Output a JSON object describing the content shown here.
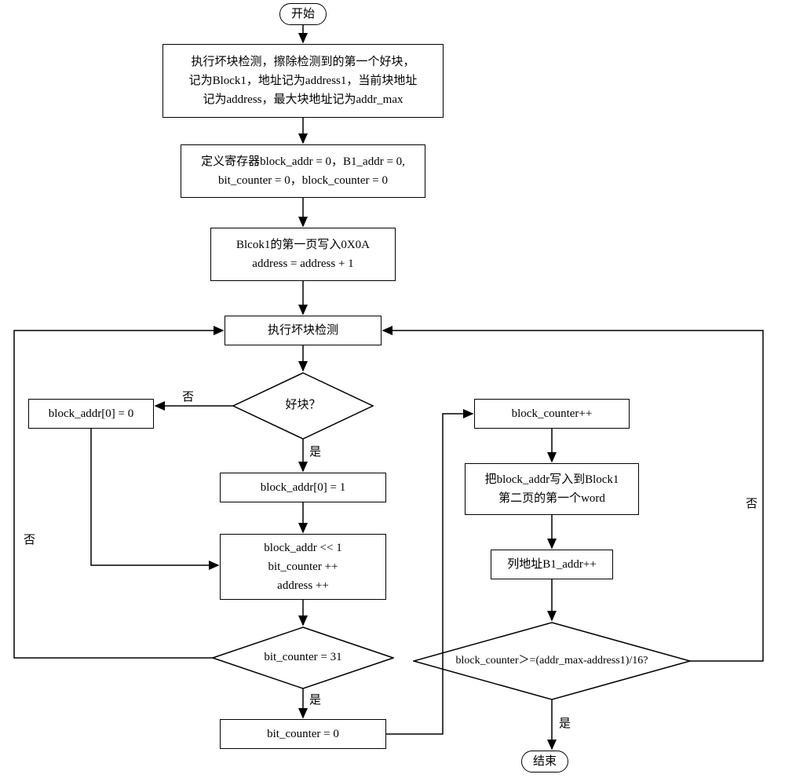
{
  "start": "开始",
  "end": "结束",
  "step1_l1": "执行坏块检测，擦除检测到的第一个好块，",
  "step1_l2": "记为Block1，地址记为address1，当前块地址",
  "step1_l3": "记为address，最大块地址记为addr_max",
  "step2_l1": "定义寄存器block_addr = 0，B1_addr = 0,",
  "step2_l2": "bit_counter = 0，block_counter = 0",
  "step3_l1": "Blcok1的第一页写入0X0A",
  "step3_l2": "address = address + 1",
  "step4": "执行坏块检测",
  "decision1": "好块？",
  "no_set": "block_addr[0] = 0",
  "yes_set": "block_addr[0] = 1",
  "shift_l1": "block_addr << 1",
  "shift_l2": "bit_counter ++",
  "shift_l3": "address ++",
  "decision2": "bit_counter = 31",
  "reset": "bit_counter = 0",
  "inc_counter": "block_counter++",
  "write_l1": "把block_addr写入到Block1",
  "write_l2": "第二页的第一个word",
  "col_addr": "列地址B1_addr++",
  "decision3": "block_counter＞=(addr_max-address1)/16?",
  "yes": "是",
  "no": "否"
}
